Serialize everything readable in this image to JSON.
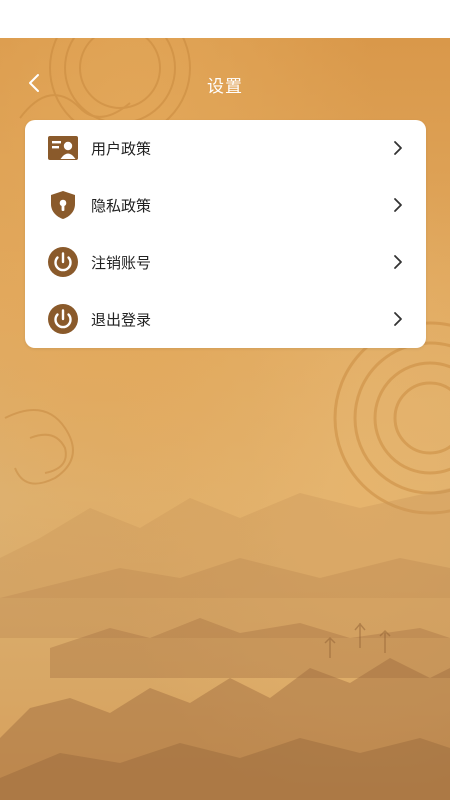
{
  "nav": {
    "title": "设置"
  },
  "settings": {
    "items": [
      {
        "label": "用户政策",
        "icon": "user-card-icon"
      },
      {
        "label": "隐私政策",
        "icon": "shield-lock-icon"
      },
      {
        "label": "注销账号",
        "icon": "power-icon"
      },
      {
        "label": "退出登录",
        "icon": "power-icon"
      }
    ]
  },
  "colors": {
    "accent_brown": "#8a5a2b",
    "background_tan": "#dfa95f",
    "card": "#ffffff",
    "text": "#222222"
  }
}
